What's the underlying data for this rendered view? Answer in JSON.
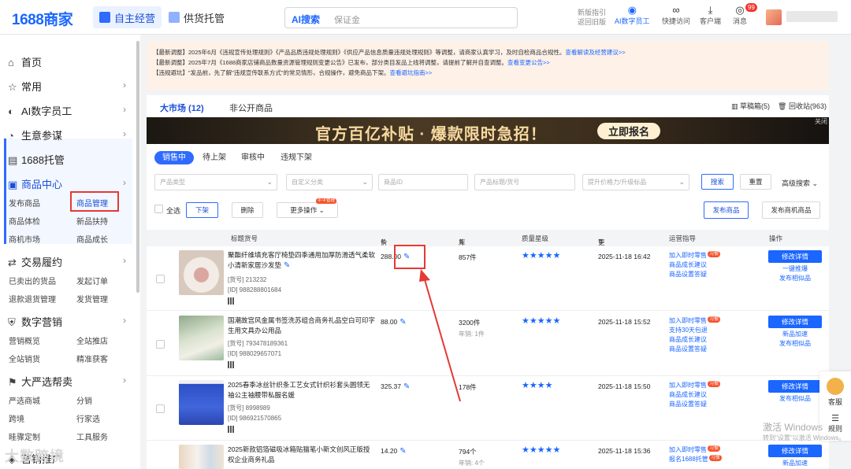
{
  "header": {
    "logo": "1688商家",
    "tabs": [
      {
        "label": "自主经营"
      },
      {
        "label": "供货托管"
      }
    ],
    "search": {
      "ai_label": "AI搜索",
      "placeholder": "保证金"
    },
    "tools": [
      {
        "label": "新版指引",
        "sub": "返回旧版",
        "icon": "guide-icon"
      },
      {
        "label": "AI数字员工",
        "icon": "robot-icon"
      },
      {
        "label": "快捷访问",
        "icon": "link-icon"
      },
      {
        "label": "客户端",
        "icon": "download-icon"
      },
      {
        "label": "消息",
        "icon": "message-icon",
        "badge": "99"
      }
    ]
  },
  "sidebar": {
    "items": [
      {
        "label": "首页",
        "icon": "home-icon"
      },
      {
        "label": "常用",
        "icon": "star-icon"
      },
      {
        "label": "AI数字员工",
        "icon": "ai-icon"
      },
      {
        "label": "生意参谋",
        "icon": "gauge-icon"
      },
      {
        "label": "1688托管",
        "icon": "box-icon"
      },
      {
        "label": "商品中心",
        "icon": "goods-icon"
      },
      {
        "label": "交易履约",
        "icon": "trade-icon"
      },
      {
        "label": "数字营销",
        "icon": "shield-icon"
      },
      {
        "label": "大严选帮卖",
        "icon": "flag-icon"
      },
      {
        "label": "营销推广",
        "icon": "megaphone-icon"
      }
    ],
    "goods_sub": [
      "发布商品",
      "商品管理",
      "商品体检",
      "新品扶持",
      "商机市场",
      "商品成长"
    ],
    "trade_sub": [
      "已卖出的货品",
      "发起订单",
      "退款退货管理",
      "发货管理"
    ],
    "marketing_sub": [
      "营销概览",
      "全站推店",
      "全站销货",
      "精准获客"
    ],
    "yanxuan_sub": [
      "严选商城",
      "分销",
      "跨境",
      "行家选",
      "眭骤定制",
      "工具服务"
    ],
    "watermark": "大数跨境"
  },
  "notice": {
    "lines": [
      {
        "text": "【最新调整】2025年6月《违规宣传处理规则》《产品品质违规处理规则》《供应产品信息质量违规处理规则》等调整，请商家认真学习，及时自检商品合规性。",
        "link": "查看解读及经营建议>>"
      },
      {
        "text": "【最新调整】2025年7月《1688商家店铺商品数量资源管理规则变更公告》已发布，部分类目发品上线将调整，请提前了解并自查调整。",
        "link": "查看变更公告>>"
      },
      {
        "text": "【违规避坑】\"发品前，先了解\"违规宣传联系方式\"的常见情形，合规操作，避免商品下架。",
        "link": "查看避坑指南>>"
      }
    ]
  },
  "main": {
    "tabs": [
      {
        "label": "大市场 (12)"
      },
      {
        "label": "非公开商品"
      }
    ],
    "draft": "草稿箱(5)",
    "recycle": "回收站(963)",
    "banner": {
      "title": "官方百亿补贴 · 爆款限时急招！",
      "button": "立即报名",
      "close": "关闭"
    },
    "status_tabs": [
      "销售中",
      "待上架",
      "审核中",
      "违规下架"
    ],
    "filters": [
      {
        "placeholder": "产品类型"
      },
      {
        "placeholder": "自定义分类"
      },
      {
        "placeholder": "商品ID"
      },
      {
        "placeholder": "产品标题/货号"
      },
      {
        "placeholder": "提升价格力/升级标品"
      }
    ],
    "search_btn": "搜索",
    "reset_btn": "重置",
    "advanced": "高级搜索",
    "select_all": "全选",
    "offshelf_btn": "下架",
    "delete_btn": "删除",
    "more_ops": "更多操作",
    "more_tag": "平平管理",
    "publish_btn": "发布商品",
    "publish_biz_btn": "发布商机商品",
    "columns": [
      "标题货号",
      "价格",
      "库存",
      "质量星级",
      "更新时间",
      "运营指导",
      "操作"
    ],
    "rows": [
      {
        "title": "聚酯纤维填充客厅椅垫四季通用加厚防滑透气柔软小清新家居沙发垫",
        "code": "[货号] 213232",
        "id": "[ID] 988288801684",
        "price": "288.00",
        "stock": "857件",
        "sold": "",
        "stars": "★★★★★",
        "time": "2025-11-18 16:42",
        "ops": [
          "加入即时零售",
          "商品成长建议",
          "商品设置答疑"
        ],
        "actions": [
          "修改详情",
          "一键推爆",
          "发布相似品"
        ],
        "img": "#e8ddd5"
      },
      {
        "title": "国潮故宫风金属书签洗苏组合商务礼品空白可印字生用文具办公用品",
        "code": "[货号] 793478189361",
        "id": "[ID] 988029657071",
        "price": "88.00",
        "stock": "3200件",
        "sold": "年销: 1件",
        "stars": "★★★★★",
        "time": "2025-11-18 15:52",
        "ops": [
          "加入即时零售",
          "支持30天包退",
          "商品成长建议",
          "商品设置答疑"
        ],
        "actions": [
          "修改详情",
          "新品加速",
          "发布相似品"
        ],
        "img": "#b9cbb6"
      },
      {
        "title": "2025春季冰丝针织条工艺女式针织衫套头圆领无袖公主袖腰带私服名媛",
        "code": "[货号] 8998989",
        "id": "[ID] 986921570865",
        "price": "325.37",
        "stock": "178件",
        "sold": "",
        "stars": "★★★★",
        "time": "2025-11-18 15:50",
        "ops": [
          "加入即时零售",
          "商品成长建议",
          "商品设置答疑"
        ],
        "actions": [
          "修改详情",
          "发布相似品"
        ],
        "img": "#3b5fd4"
      },
      {
        "title": "2025新款铝箔磁吸冰箱贴猫笔小新文创风正版授权企业商务礼品",
        "code": "",
        "id": "",
        "price": "14.20",
        "stock": "794个",
        "sold": "年销: 4个",
        "stars": "★★★★★",
        "time": "2025-11-18 15:36",
        "ops": [
          "加入即时零售",
          "报名1688托管"
        ],
        "actions": [
          "修改详情",
          "新品加速"
        ],
        "img": "#e9e2d6"
      }
    ]
  },
  "float": {
    "service": "客服",
    "rules": "规则"
  },
  "windows": {
    "title": "激活 Windows",
    "sub": "转到\"设置\"以激活 Windows。"
  }
}
